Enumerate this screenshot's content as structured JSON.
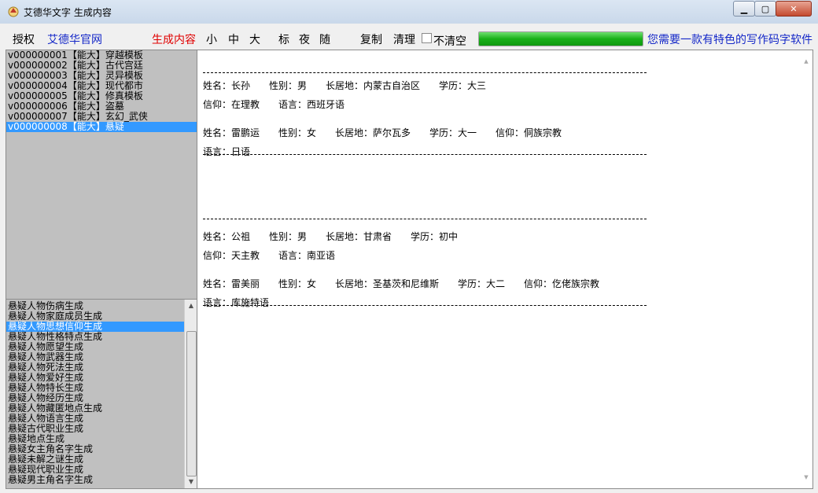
{
  "window": {
    "title": "艾德华文字 生成内容",
    "buttons": [
      "minimize-icon",
      "maximize-icon",
      "close-icon"
    ]
  },
  "toolbar": {
    "auth": "授权",
    "site": "艾德华官网",
    "generate": "生成内容",
    "small": "小",
    "medium": "中",
    "large": "大",
    "mark": "标",
    "night": "夜",
    "random": "随",
    "copy": "复制",
    "clear": "清理",
    "no_clear": "不清空",
    "no_clear_checked": false,
    "progress": 1.0,
    "slogan": "您需要一款有特色的写作码字软件"
  },
  "templates": [
    "v000000001【能大】穿越模板",
    "v000000002【能大】古代宫廷",
    "v000000003【能大】灵异模板",
    "v000000004【能大】现代都市",
    "v000000005【能大】修真模板",
    "v000000006【能大】盗墓",
    "v000000007【能大】玄幻_武侠",
    "v000000008【能大】悬疑"
  ],
  "selected_template": 7,
  "generators": [
    "悬疑人物伤病生成",
    "悬疑人物家庭成员生成",
    "悬疑人物思想信仰生成",
    "悬疑人物性格特点生成",
    "悬疑人物愿望生成",
    "悬疑人物武器生成",
    "悬疑人物死法生成",
    "悬疑人物爱好生成",
    "悬疑人物特长生成",
    "悬疑人物经历生成",
    "悬疑人物藏匿地点生成",
    "悬疑人物语言生成",
    "悬疑古代职业生成",
    "悬疑地点生成",
    "悬疑女主角名字生成",
    "悬疑未解之谜生成",
    "悬疑现代职业生成",
    "悬疑男主角名字生成"
  ],
  "selected_generator": 2,
  "content": {
    "records": [
      {
        "l1": "姓名：长孙　　性别：男　　长居地：内蒙古自治区　　学历：大三",
        "l2": "信仰：在理教　　语言：西班牙语"
      },
      {
        "l1": "姓名：雷鹏运　　性别：女　　长居地：萨尔瓦多　　学历：大一　　信仰：侗族宗教",
        "l2": "语言：日语"
      },
      {
        "l1": "姓名：公祖　　性别：男　　长居地：甘肃省　　学历：初中",
        "l2": "信仰：天主教　　语言：南亚语"
      },
      {
        "l1": "姓名：雷美丽　　性别：女　　长居地：圣基茨和尼维斯　　学历：大二　　信仰：仡佬族宗教",
        "l2": "语言：库施特语"
      }
    ]
  }
}
